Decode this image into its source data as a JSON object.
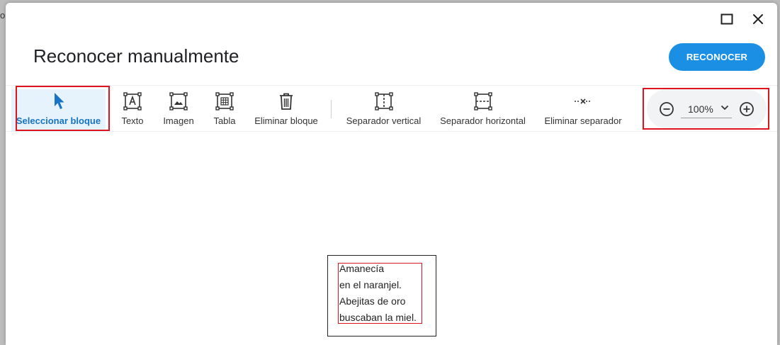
{
  "backdrop": {
    "glyph": "o"
  },
  "dialog": {
    "title": "Reconocer manualmente",
    "primary_button": "RECONOCER",
    "window_controls": [
      {
        "name": "maximize-icon"
      },
      {
        "name": "close-icon"
      }
    ]
  },
  "toolbar": {
    "select_block": "Seleccionar bloque",
    "text": "Texto",
    "image": "Imagen",
    "table": "Tabla",
    "delete_block": "Eliminar bloque",
    "vertical_separator": "Separador vertical",
    "horizontal_separator": "Separador horizontal",
    "delete_separator": "Eliminar separador",
    "active_tool": "Seleccionar bloque"
  },
  "zoom": {
    "value": "100%",
    "options": [
      "100%"
    ]
  },
  "document": {
    "lines": [
      "Amanecía",
      "en el naranjel.",
      "Abejitas de oro",
      "buscaban la miel."
    ]
  },
  "colors": {
    "accent": "#1a8fe3",
    "active_tool_bg": "#e6f2fc",
    "highlight_border": "#e0141e"
  }
}
